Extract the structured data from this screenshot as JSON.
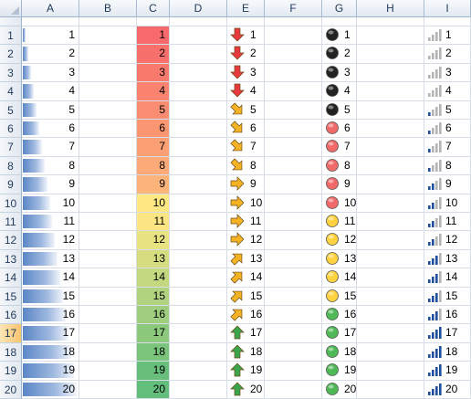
{
  "columns": [
    "A",
    "B",
    "C",
    "D",
    "E",
    "F",
    "G",
    "H",
    "I"
  ],
  "selected_row": 17,
  "rows": [
    {
      "row": 1,
      "value": 1,
      "color_scale": "#f8696b",
      "arrow": "down",
      "circle": "black",
      "signal": 1
    },
    {
      "row": 2,
      "value": 2,
      "color_scale": "#f8706c",
      "arrow": "down",
      "circle": "black",
      "signal": 1
    },
    {
      "row": 3,
      "value": 3,
      "color_scale": "#f9796d",
      "arrow": "down",
      "circle": "black",
      "signal": 1
    },
    {
      "row": 4,
      "value": 4,
      "color_scale": "#f9836f",
      "arrow": "down",
      "circle": "black",
      "signal": 1
    },
    {
      "row": 5,
      "value": 5,
      "color_scale": "#fa8c71",
      "arrow": "down-right",
      "circle": "black",
      "signal": 2
    },
    {
      "row": 6,
      "value": 6,
      "color_scale": "#fb9673",
      "arrow": "down-right",
      "circle": "red",
      "signal": 2
    },
    {
      "row": 7,
      "value": 7,
      "color_scale": "#fba075",
      "arrow": "down-right",
      "circle": "red",
      "signal": 2
    },
    {
      "row": 8,
      "value": 8,
      "color_scale": "#fcaa77",
      "arrow": "down-right",
      "circle": "red",
      "signal": 2
    },
    {
      "row": 9,
      "value": 9,
      "color_scale": "#fdb47a",
      "arrow": "right",
      "circle": "red",
      "signal": 3
    },
    {
      "row": 10,
      "value": 10,
      "color_scale": "#fee883",
      "arrow": "right",
      "circle": "red",
      "signal": 3
    },
    {
      "row": 11,
      "value": 11,
      "color_scale": "#fbe683",
      "arrow": "right",
      "circle": "yellow",
      "signal": 3
    },
    {
      "row": 12,
      "value": 12,
      "color_scale": "#e9e382",
      "arrow": "right",
      "circle": "yellow",
      "signal": 3
    },
    {
      "row": 13,
      "value": 13,
      "color_scale": "#d6dd81",
      "arrow": "up-right",
      "circle": "yellow",
      "signal": 4
    },
    {
      "row": 14,
      "value": 14,
      "color_scale": "#c4d880",
      "arrow": "up-right",
      "circle": "yellow",
      "signal": 4
    },
    {
      "row": 15,
      "value": 15,
      "color_scale": "#b1d37f",
      "arrow": "up-right",
      "circle": "yellow",
      "signal": 4
    },
    {
      "row": 16,
      "value": 16,
      "color_scale": "#9ece7e",
      "arrow": "up-right",
      "circle": "green",
      "signal": 4
    },
    {
      "row": 17,
      "value": 17,
      "color_scale": "#8cc97d",
      "arrow": "up",
      "circle": "green",
      "signal": 5
    },
    {
      "row": 18,
      "value": 18,
      "color_scale": "#7ac47c",
      "arrow": "up",
      "circle": "green",
      "signal": 5
    },
    {
      "row": 19,
      "value": 19,
      "color_scale": "#68bf7b",
      "arrow": "up",
      "circle": "green",
      "signal": 5
    },
    {
      "row": 20,
      "value": 20,
      "color_scale": "#63be7b",
      "arrow": "up",
      "circle": "green",
      "signal": 5
    }
  ],
  "icon_colors": {
    "red": "#e8393c",
    "orange": "#f5b324",
    "green": "#3aa54a",
    "circle_black": "#222222",
    "circle_red": "#f06a6a",
    "circle_yellow": "#ffd23f",
    "circle_green": "#4fb857",
    "signal_on": "#1f4e9c",
    "signal_off": "#b4b4b4"
  }
}
